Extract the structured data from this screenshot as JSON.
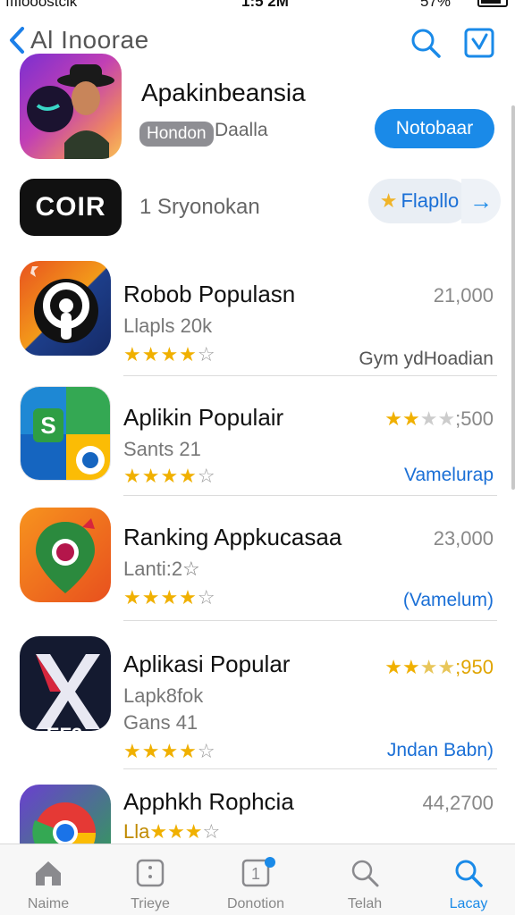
{
  "status": {
    "carrier": "ııılooostcik",
    "time": "1:5 2M",
    "battery": "57%"
  },
  "nav": {
    "back_label": "Al Inoorae"
  },
  "featured": {
    "title": "Apakinbeansia",
    "chip": "Hondon",
    "sub": "Daalla",
    "button": "Notobaar"
  },
  "promo": {
    "logo": "COIR",
    "text": "1 Sryonokan",
    "button": "Flapllo"
  },
  "apps": [
    {
      "name": "Robob Populasn",
      "meta1": "Llapls 20k",
      "meta2": "",
      "right_num": "21,000",
      "right_rating": "",
      "link": "Gym ydHoadian",
      "stars": 4
    },
    {
      "name": "Aplikin Populair",
      "meta1": "Sants 21",
      "meta2": "",
      "right_num": "",
      "right_rating": ";500",
      "link": "Vamelurap",
      "stars": 4
    },
    {
      "name": "Ranking Appkucasaa",
      "meta1": "Lanti:2☆",
      "meta2": "",
      "right_num": "23,000",
      "right_rating": "",
      "link": "(Vamelum)",
      "stars": 4
    },
    {
      "name": "Aplikasi Popular",
      "meta1": "Lapk8fok",
      "meta2": "Gans 41",
      "right_num": "",
      "right_rating": ";950",
      "link": "Jndan Babn)",
      "stars": 4
    },
    {
      "name": "Apphkh Rophcia",
      "meta1": "Lla",
      "meta2": "",
      "right_num": "44,2700",
      "right_rating": "",
      "link": "",
      "stars": 3
    }
  ],
  "tabs": [
    {
      "label": "Naime",
      "icon": "home-icon"
    },
    {
      "label": "Trieye",
      "icon": "grid-icon"
    },
    {
      "label": "Donotion",
      "icon": "notification-icon"
    },
    {
      "label": "Telah",
      "icon": "search-icon"
    },
    {
      "label": "Lacay",
      "icon": "search-icon"
    }
  ],
  "colors": {
    "accent": "#1a8ae8",
    "star": "#f0b000"
  }
}
